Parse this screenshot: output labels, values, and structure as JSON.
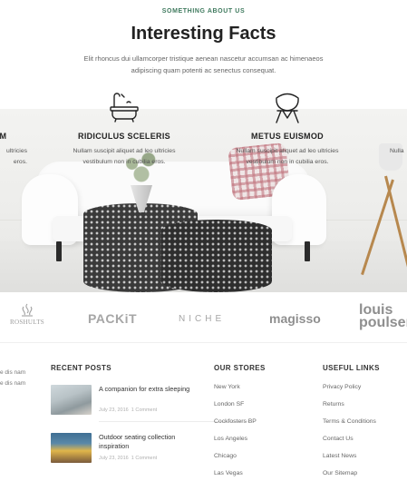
{
  "facts_section": {
    "eyebrow": "SOMETHING ABOUT US",
    "title": "Interesting Facts",
    "subtitle": "Elit rhoncus dui ullamcorper tristique aenean nascetur accumsan ac himenaeos adipiscing quam potenti ac senectus consequat.",
    "features": [
      {
        "title": "UM",
        "text_line1": "ultricies",
        "text_line2": "eros.",
        "icon": "none"
      },
      {
        "title": "RIDICULUS SCELERIS",
        "text_line1": "Nullam suscipit aliquet ad leo ultricies",
        "text_line2": "vestibulum non in cubilia eros.",
        "icon": "bathtub-icon"
      },
      {
        "title": "METUS EUISMOD",
        "text_line1": "Nullam suscipit aliquet ad leo ultricies",
        "text_line2": "vestibulum non in cubilia eros.",
        "icon": "chair-icon"
      },
      {
        "title": "",
        "text_line1": "Nulla",
        "text_line2": "",
        "icon": "none"
      }
    ]
  },
  "brands": [
    "ROSHULTS",
    "PACKiT",
    "NICHE",
    "magisso",
    "louis",
    "poulsen"
  ],
  "footer": {
    "left_fragment": {
      "line1": "e dis nam",
      "line2": "e dis nam"
    },
    "recent_posts": {
      "heading": "RECENT POSTS",
      "posts": [
        {
          "title": "A companion for extra sleeping",
          "date": "July 23, 2016",
          "comments": "1 Comment"
        },
        {
          "title": "Outdoor seating collection inspiration",
          "date": "July 23, 2016",
          "comments": "1 Comment"
        }
      ]
    },
    "our_stores": {
      "heading": "OUR STORES",
      "links": [
        "New York",
        "London SF",
        "Cockfosters BP",
        "Los Angeles",
        "Chicago",
        "Las Vegas"
      ]
    },
    "useful_links": {
      "heading": "USEFUL LINKS",
      "links": [
        "Privacy Policy",
        "Returns",
        "Terms & Conditions",
        "Contact Us",
        "Latest News",
        "Our Sitemap"
      ]
    }
  },
  "colors": {
    "accent": "#3f7a5e",
    "heading": "#222222",
    "brand_gray": "#9a9a9a"
  }
}
